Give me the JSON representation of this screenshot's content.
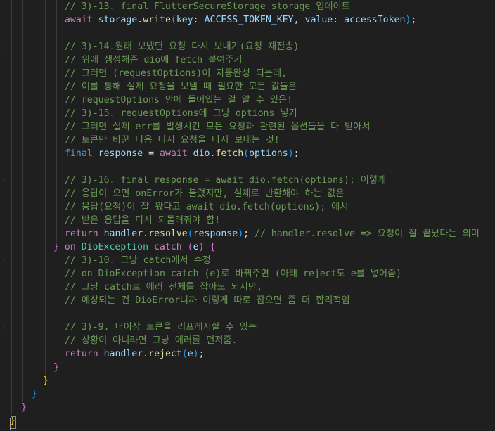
{
  "editor": {
    "lines": [
      {
        "indent": 92,
        "tokens": [
          {
            "c": "cm",
            "t": "// 3)-13. final FlutterSecureStorage storage 업데이트"
          }
        ]
      },
      {
        "indent": 92,
        "tokens": [
          {
            "c": "kw2",
            "t": "await"
          },
          {
            "c": "p",
            "t": " "
          },
          {
            "c": "id",
            "t": "storage"
          },
          {
            "c": "p",
            "t": "."
          },
          {
            "c": "fn",
            "t": "write"
          },
          {
            "c": "b3",
            "t": "("
          },
          {
            "c": "id",
            "t": "key"
          },
          {
            "c": "p",
            "t": ": "
          },
          {
            "c": "id",
            "t": "ACCESS_TOKEN_KEY"
          },
          {
            "c": "p",
            "t": ", "
          },
          {
            "c": "id",
            "t": "value"
          },
          {
            "c": "p",
            "t": ": "
          },
          {
            "c": "id",
            "t": "accessToken"
          },
          {
            "c": "b3",
            "t": ")"
          },
          {
            "c": "p",
            "t": ";"
          }
        ]
      },
      {
        "indent": 92,
        "tokens": []
      },
      {
        "indent": 92,
        "tokens": [
          {
            "c": "cm",
            "t": "// 3)-14.원래 보냈던 요청 다시 보내기(요청 재전송)"
          }
        ]
      },
      {
        "indent": 92,
        "tokens": [
          {
            "c": "cm",
            "t": "// 위에 생성해준 dio에 fetch 붙여주기"
          }
        ]
      },
      {
        "indent": 92,
        "tokens": [
          {
            "c": "cm",
            "t": "// 그러면 (requestOptions)이 자동완성 되는데,"
          }
        ]
      },
      {
        "indent": 92,
        "tokens": [
          {
            "c": "cm",
            "t": "// 이를 통해 실제 요청을 보낼 때 필요한 모든 값들은"
          }
        ]
      },
      {
        "indent": 92,
        "tokens": [
          {
            "c": "cm",
            "t": "// requestOptions 안에 들어있는 걸 알 수 있음!"
          }
        ]
      },
      {
        "indent": 92,
        "tokens": [
          {
            "c": "cm",
            "t": "// 3)-15. requestOptions에 그냥 options 넣기"
          }
        ]
      },
      {
        "indent": 92,
        "tokens": [
          {
            "c": "cm",
            "t": "// 그러면 실제 err를 발생시킨 모든 요청과 관련된 옵션들을 다 받아서"
          }
        ]
      },
      {
        "indent": 92,
        "tokens": [
          {
            "c": "cm",
            "t": "// 토큰만 바꾼 다음 다시 요청을 다시 보내는 것!"
          }
        ]
      },
      {
        "indent": 92,
        "tokens": [
          {
            "c": "kw",
            "t": "final"
          },
          {
            "c": "p",
            "t": " "
          },
          {
            "c": "id",
            "t": "response"
          },
          {
            "c": "p",
            "t": " = "
          },
          {
            "c": "kw2",
            "t": "await"
          },
          {
            "c": "p",
            "t": " "
          },
          {
            "c": "id",
            "t": "dio"
          },
          {
            "c": "p",
            "t": "."
          },
          {
            "c": "fn",
            "t": "fetch"
          },
          {
            "c": "b3",
            "t": "("
          },
          {
            "c": "id",
            "t": "options"
          },
          {
            "c": "b3",
            "t": ")"
          },
          {
            "c": "p",
            "t": ";"
          }
        ]
      },
      {
        "indent": 92,
        "tokens": []
      },
      {
        "indent": 92,
        "tokens": [
          {
            "c": "cm",
            "t": "// 3)-16. final response = await dio.fetch(options); 이렇게"
          }
        ]
      },
      {
        "indent": 92,
        "tokens": [
          {
            "c": "cm",
            "t": "// 응답이 오면 onError가 불렸지만, 실제로 반환해야 하는 값은"
          }
        ]
      },
      {
        "indent": 92,
        "tokens": [
          {
            "c": "cm",
            "t": "// 응답(요청)이 잘 왔다고 await dio.fetch(options); 에서"
          }
        ]
      },
      {
        "indent": 92,
        "tokens": [
          {
            "c": "cm",
            "t": "// 받은 응답을 다시 되돌려줘야 함!"
          }
        ]
      },
      {
        "indent": 92,
        "tokens": [
          {
            "c": "kw2",
            "t": "return"
          },
          {
            "c": "p",
            "t": " "
          },
          {
            "c": "id",
            "t": "handler"
          },
          {
            "c": "p",
            "t": "."
          },
          {
            "c": "fn",
            "t": "resolve"
          },
          {
            "c": "b3",
            "t": "("
          },
          {
            "c": "id",
            "t": "response"
          },
          {
            "c": "b3",
            "t": ")"
          },
          {
            "c": "p",
            "t": "; "
          },
          {
            "c": "cm",
            "t": "// handler.resolve => 요청이 잘 끝났다는 의미"
          }
        ]
      },
      {
        "indent": 76,
        "tokens": [
          {
            "c": "b2",
            "t": "}"
          },
          {
            "c": "p",
            "t": " "
          },
          {
            "c": "kw2",
            "t": "on"
          },
          {
            "c": "p",
            "t": " "
          },
          {
            "c": "ty",
            "t": "DioException"
          },
          {
            "c": "p",
            "t": " "
          },
          {
            "c": "kw2",
            "t": "catch"
          },
          {
            "c": "p",
            "t": " "
          },
          {
            "c": "b2",
            "t": "("
          },
          {
            "c": "id",
            "t": "e"
          },
          {
            "c": "b2",
            "t": ")"
          },
          {
            "c": "p",
            "t": " "
          },
          {
            "c": "b2",
            "t": "{"
          }
        ]
      },
      {
        "indent": 92,
        "tokens": [
          {
            "c": "cm",
            "t": "// 3)-10. 그냥 catch에서 수정"
          }
        ]
      },
      {
        "indent": 92,
        "tokens": [
          {
            "c": "cm",
            "t": "// on DioException catch (e)로 바꿔주면 (아래 reject도 e를 넣어줌)"
          }
        ]
      },
      {
        "indent": 92,
        "tokens": [
          {
            "c": "cm",
            "t": "// 그냥 catch로 에러 전체를 잡아도 되지만,"
          }
        ]
      },
      {
        "indent": 92,
        "tokens": [
          {
            "c": "cm",
            "t": "// 예상되는 건 DioError니까 이렇게 따로 잡으면 좀 더 합리적임"
          }
        ]
      },
      {
        "indent": 92,
        "tokens": []
      },
      {
        "indent": 92,
        "tokens": [
          {
            "c": "cm",
            "t": "// 3)-9. 더이상 토큰을 리프레시할 수 있는"
          }
        ]
      },
      {
        "indent": 92,
        "tokens": [
          {
            "c": "cm",
            "t": "// 상황이 아니라면 그냥 에러를 던져줌."
          }
        ]
      },
      {
        "indent": 92,
        "tokens": [
          {
            "c": "kw2",
            "t": "return"
          },
          {
            "c": "p",
            "t": " "
          },
          {
            "c": "id",
            "t": "handler"
          },
          {
            "c": "p",
            "t": "."
          },
          {
            "c": "fn",
            "t": "reject"
          },
          {
            "c": "b3",
            "t": "("
          },
          {
            "c": "id",
            "t": "e"
          },
          {
            "c": "b3",
            "t": ")"
          },
          {
            "c": "p",
            "t": ";"
          }
        ]
      },
      {
        "indent": 76,
        "tokens": [
          {
            "c": "b2",
            "t": "}"
          }
        ]
      },
      {
        "indent": 61,
        "tokens": [
          {
            "c": "b1",
            "t": "}"
          }
        ]
      },
      {
        "indent": 45,
        "tokens": [
          {
            "c": "b3",
            "t": "}"
          }
        ]
      },
      {
        "indent": 30,
        "tokens": [
          {
            "c": "b2",
            "t": "}"
          }
        ]
      },
      {
        "indent": 14,
        "tokens": [
          {
            "c": "b1",
            "t": "}"
          }
        ]
      }
    ]
  },
  "icons": {
    "fold": "chevron-right-icon"
  }
}
